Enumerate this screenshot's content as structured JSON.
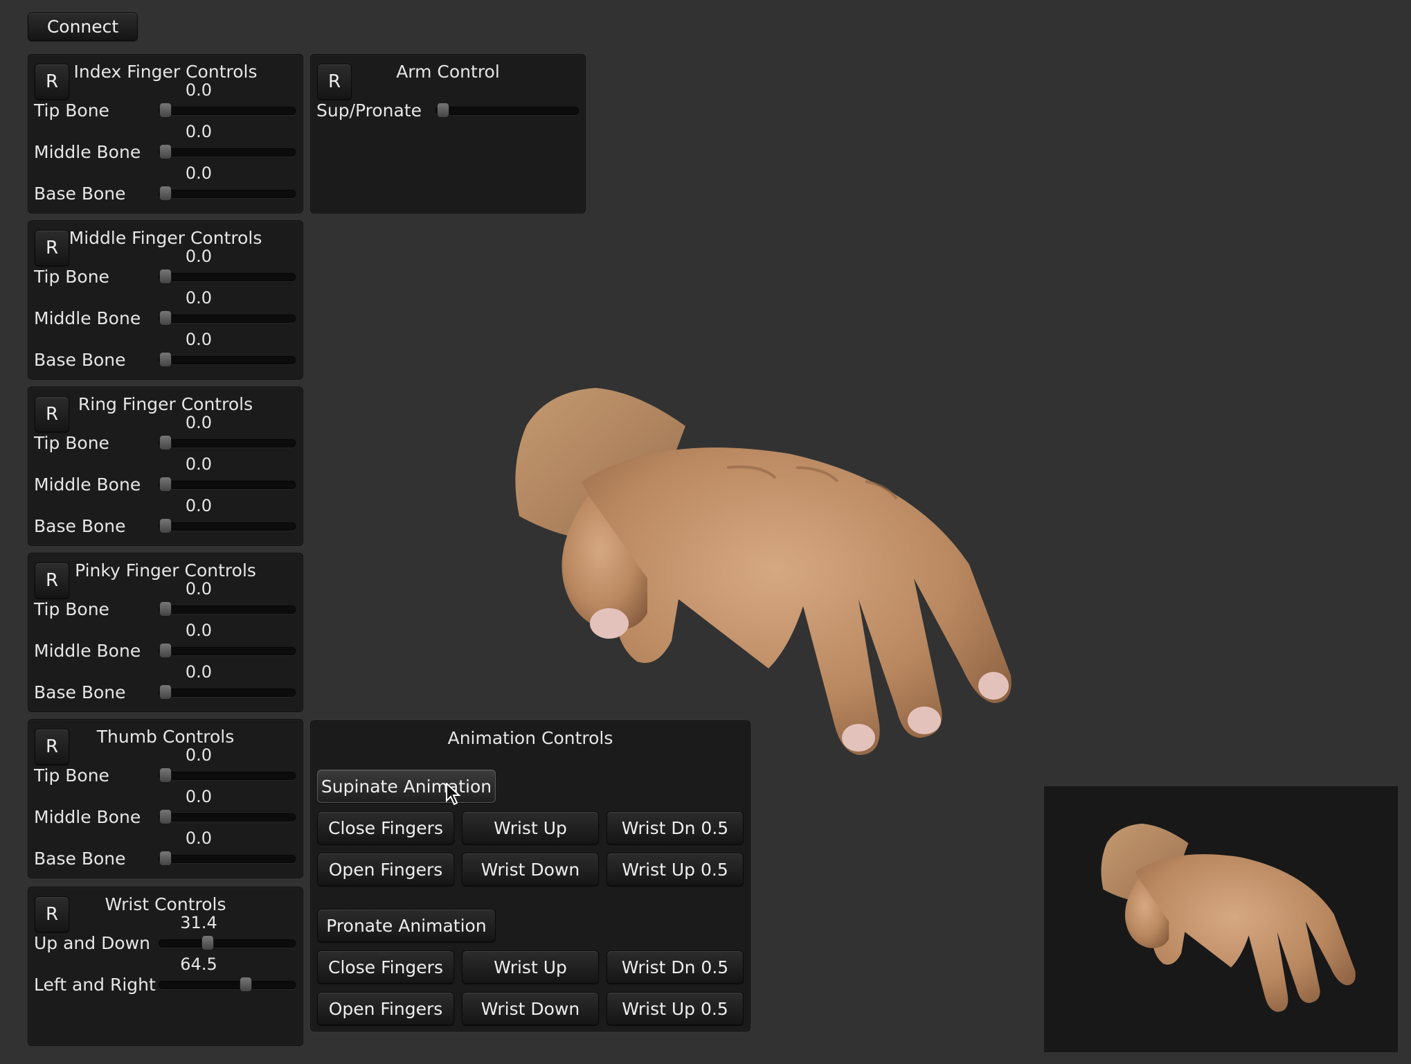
{
  "top": {
    "connect_label": "Connect"
  },
  "reset_label": "R",
  "finger_panels": [
    {
      "title": "Index Finger Controls",
      "rows": [
        {
          "label": "Tip Bone",
          "value": "0.0",
          "position": 0.0
        },
        {
          "label": "Middle Bone",
          "value": "0.0",
          "position": 0.0
        },
        {
          "label": "Base Bone",
          "value": "0.0",
          "position": 0.0
        }
      ]
    },
    {
      "title": "Middle Finger Controls",
      "rows": [
        {
          "label": "Tip Bone",
          "value": "0.0",
          "position": 0.0
        },
        {
          "label": "Middle Bone",
          "value": "0.0",
          "position": 0.0
        },
        {
          "label": "Base Bone",
          "value": "0.0",
          "position": 0.0
        }
      ]
    },
    {
      "title": "Ring Finger Controls",
      "rows": [
        {
          "label": "Tip Bone",
          "value": "0.0",
          "position": 0.0
        },
        {
          "label": "Middle Bone",
          "value": "0.0",
          "position": 0.0
        },
        {
          "label": "Base Bone",
          "value": "0.0",
          "position": 0.0
        }
      ]
    },
    {
      "title": "Pinky Finger Controls",
      "rows": [
        {
          "label": "Tip Bone",
          "value": "0.0",
          "position": 0.0
        },
        {
          "label": "Middle Bone",
          "value": "0.0",
          "position": 0.0
        },
        {
          "label": "Base Bone",
          "value": "0.0",
          "position": 0.0
        }
      ]
    },
    {
      "title": "Thumb Controls",
      "rows": [
        {
          "label": "Tip Bone",
          "value": "0.0",
          "position": 0.0
        },
        {
          "label": "Middle Bone",
          "value": "0.0",
          "position": 0.0
        },
        {
          "label": "Base Bone",
          "value": "0.0",
          "position": 0.0
        }
      ]
    }
  ],
  "wrist_panel": {
    "title": "Wrist Controls",
    "rows": [
      {
        "label": "Up and Down",
        "value": "31.4",
        "position": 0.34
      },
      {
        "label": "Left and Right",
        "value": "64.5",
        "position": 0.65
      }
    ]
  },
  "arm_panel": {
    "title": "Arm Control",
    "rows": [
      {
        "label": "Sup/Pronate",
        "value": "",
        "position": 0.0
      }
    ]
  },
  "animation": {
    "title": "Animation Controls",
    "supinate_label": "Supinate Animation",
    "pronate_label": "Pronate Animation",
    "grid_labels": [
      [
        "Close Fingers",
        "Wrist Up",
        "Wrist Dn 0.5"
      ],
      [
        "Open Fingers",
        "Wrist Down",
        "Wrist Up 0.5"
      ]
    ]
  }
}
